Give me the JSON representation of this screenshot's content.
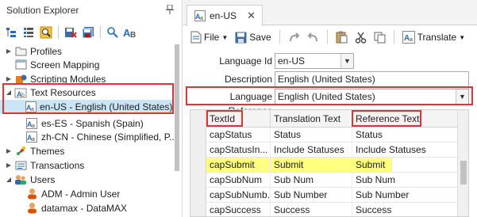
{
  "solution_explorer": {
    "title": "Solution Explorer",
    "tree": [
      {
        "label": "Profiles",
        "icon": "folder-icon",
        "expanded": false
      },
      {
        "label": "Screen Mapping",
        "icon": "screen-mapping-icon",
        "expanded": null
      },
      {
        "label": "Scripting Modules",
        "icon": "scripting-icon",
        "expanded": false
      },
      {
        "label": "Text Resources",
        "icon": "text-resources-icon",
        "expanded": true
      },
      {
        "label": "en-US - English (United States)",
        "icon": "language-icon",
        "selected": true
      },
      {
        "label": "es-ES - Spanish (Spain)",
        "icon": "language-icon"
      },
      {
        "label": "zh-CN - Chinese (Simplified, P...",
        "icon": "language-icon"
      },
      {
        "label": "Themes",
        "icon": "themes-icon",
        "expanded": false
      },
      {
        "label": "Transactions",
        "icon": "transactions-icon",
        "expanded": false
      },
      {
        "label": "Users",
        "icon": "users-icon",
        "expanded": true
      },
      {
        "label": "ADM - Admin User",
        "icon": "user-icon"
      },
      {
        "label": "datamax - DataMAX",
        "icon": "user-icon"
      }
    ]
  },
  "document": {
    "tab_label": "en-US",
    "toolbar": {
      "file_label": "File",
      "save_label": "Save",
      "translate_label": "Translate"
    },
    "form": {
      "language_id_label": "Language Id",
      "language_id_value": "en-US",
      "description_label": "Description",
      "description_value": "English (United States)",
      "language_reference_label": "Language Reference",
      "language_reference_value": "English (United States)"
    },
    "grid": {
      "columns": [
        "TextId",
        "Translation Text",
        "Reference Text"
      ],
      "rows": [
        [
          "capStatus",
          "Status",
          "Status"
        ],
        [
          "capStatusIn...",
          "Include Statuses",
          "Include Statuses"
        ],
        [
          "",
          "",
          ""
        ],
        [
          "capSubmit",
          "Submit",
          "Submit"
        ],
        [
          "capSubNum",
          "Sub Num",
          "Sub Num"
        ],
        [
          "capSubNumb...",
          "Sub Number",
          "Sub Number"
        ],
        [
          "capSuccess",
          "Success",
          "Success"
        ]
      ],
      "highlighted_row": 3
    }
  },
  "colors": {
    "highlight_box": "#e03333",
    "selected_row": "#cce4f7",
    "grid_highlight": "#ffff80"
  }
}
